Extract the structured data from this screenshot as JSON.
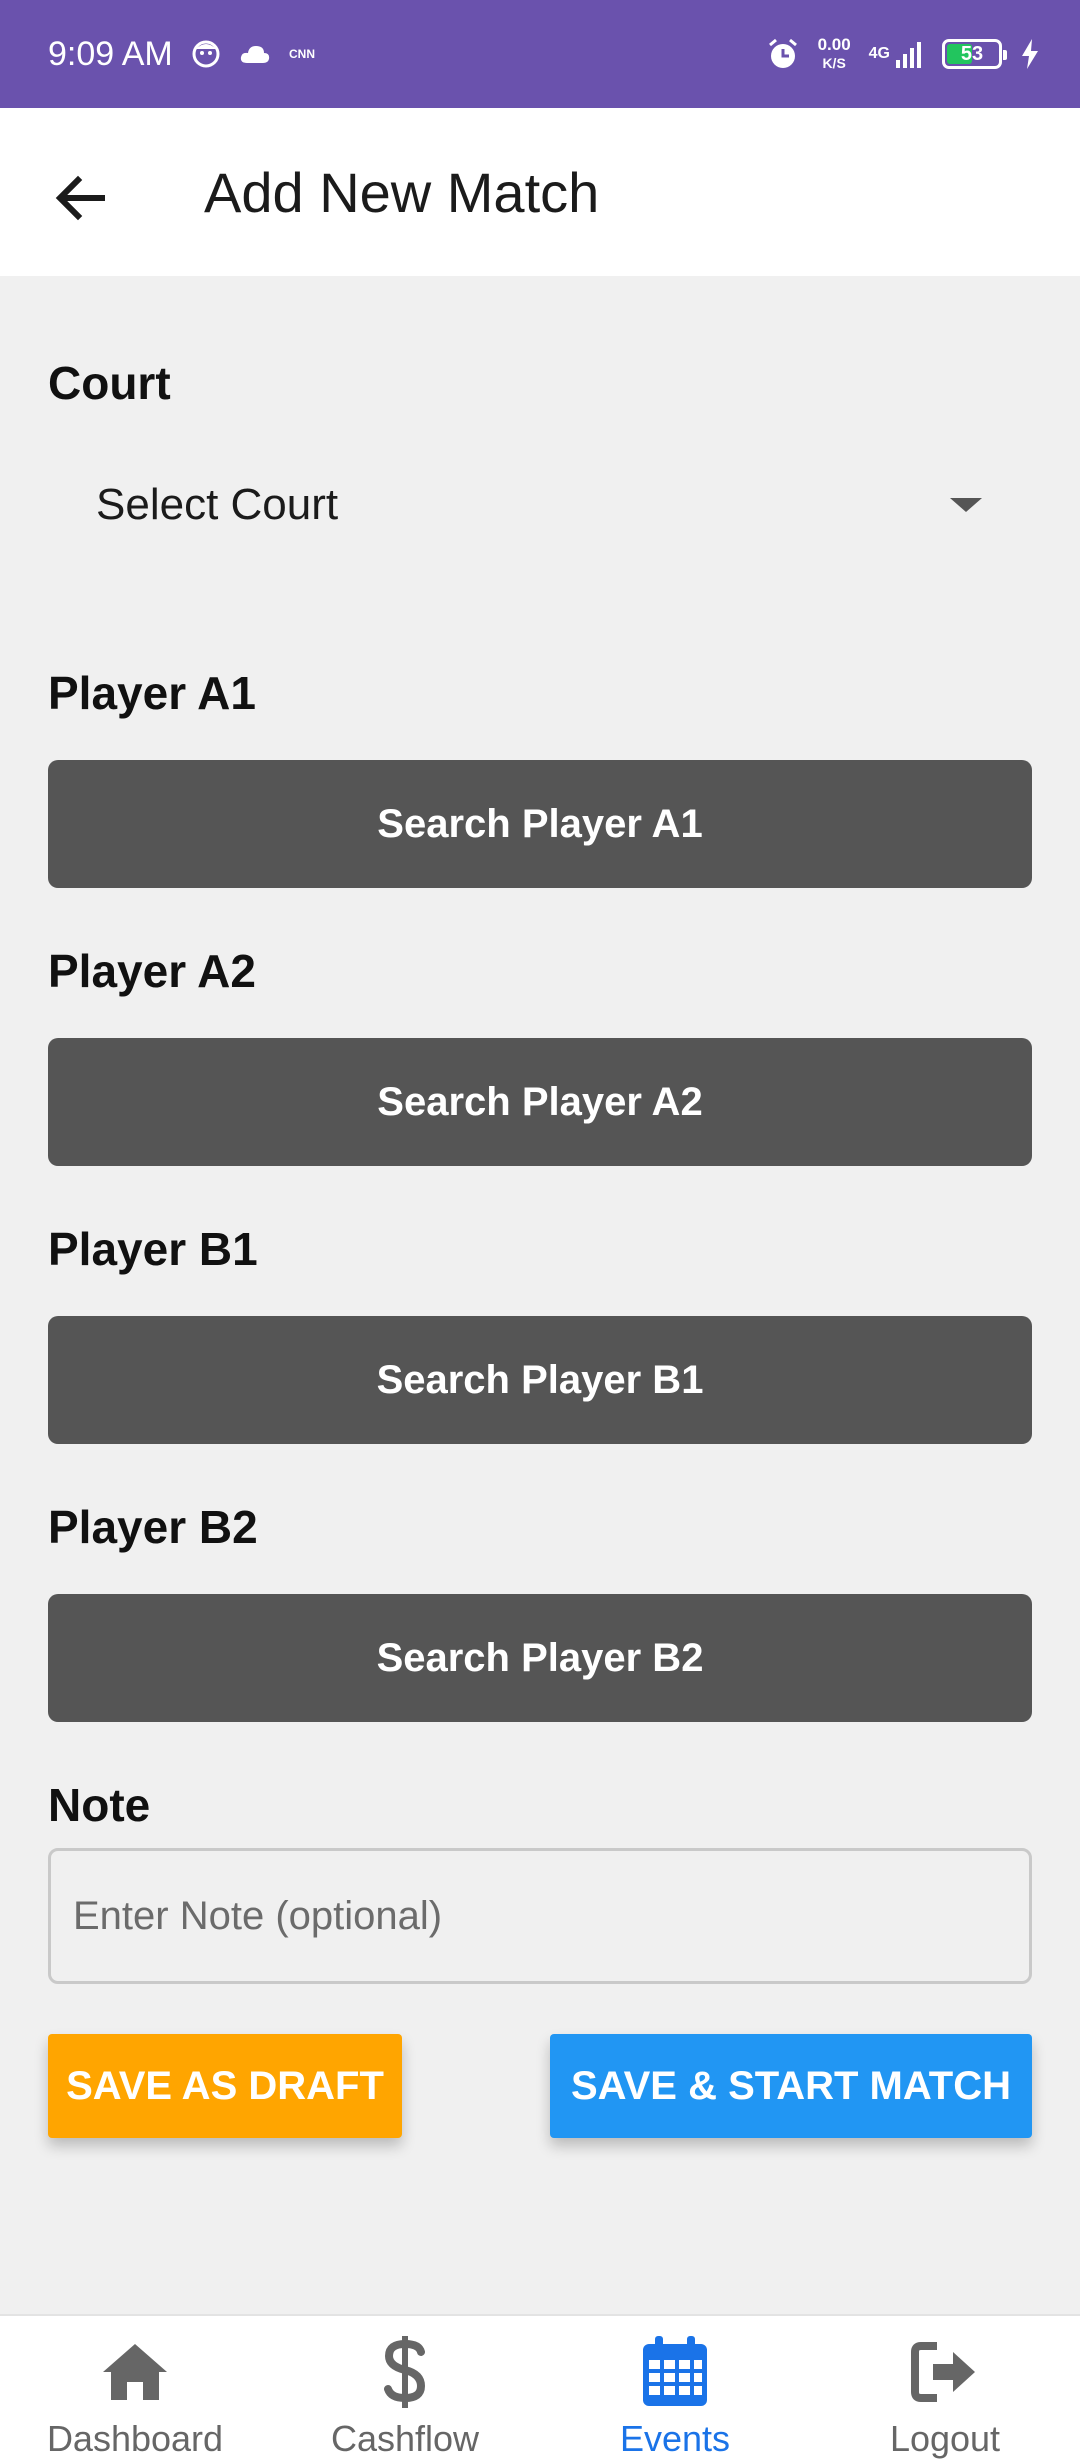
{
  "status_bar": {
    "time": "9:09 AM",
    "net_speed_value": "0.00",
    "net_speed_unit": "K/S",
    "network": "4G",
    "battery": "53",
    "battery_level": 0.53,
    "icons": [
      "face-icon",
      "cloud-icon",
      "cnn-icon",
      "alarm-icon",
      "signal-icon",
      "battery-icon",
      "charging-icon"
    ]
  },
  "app_bar": {
    "title": "Add New Match",
    "back_icon": "arrow-left-icon"
  },
  "form": {
    "court": {
      "label": "Court",
      "selected": "Select Court"
    },
    "players": [
      {
        "label": "Player A1",
        "button": "Search Player A1"
      },
      {
        "label": "Player A2",
        "button": "Search Player A2"
      },
      {
        "label": "Player B1",
        "button": "Search Player B1"
      },
      {
        "label": "Player B2",
        "button": "Search Player B2"
      }
    ],
    "note": {
      "label": "Note",
      "placeholder": "Enter Note (optional)",
      "value": ""
    },
    "save_draft_label": "SAVE AS DRAFT",
    "save_start_label": "SAVE & START MATCH"
  },
  "bottom_nav": {
    "items": [
      {
        "label": "Dashboard",
        "icon": "home-icon",
        "active": false
      },
      {
        "label": "Cashflow",
        "icon": "dollar-icon",
        "active": false
      },
      {
        "label": "Events",
        "icon": "calendar-icon",
        "active": true
      },
      {
        "label": "Logout",
        "icon": "logout-icon",
        "active": false
      }
    ]
  },
  "colors": {
    "status_bar": "#6a52ad",
    "draft": "#ffa500",
    "start": "#2196f3",
    "search_button": "#555555",
    "nav_active": "#1a73e8"
  }
}
